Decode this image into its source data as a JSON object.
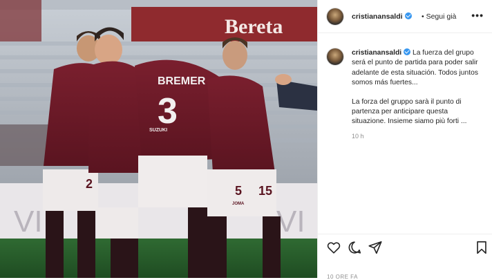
{
  "post": {
    "username": "cristianansaldi",
    "follow_label": "• Segui già",
    "more_label": "•••",
    "caption_es": "La fuerza del grupo será el punto de partida para poder salir adelante de esta situación. Todos juntos somos más fuertes...",
    "caption_it": "La forza del gruppo sarà il punto di partenza per anticipare questa situazione. Insieme siamo più forti ...",
    "time_ago": "10 h",
    "date_label": "10 ORE FA"
  },
  "photo": {
    "banner_text": "Bereta",
    "player_name": "BREMER",
    "player_number": "3",
    "number_2": "2",
    "number_5": "5",
    "number_15": "15",
    "sponsor": "SUZUKI",
    "kit_brand": "JOMA",
    "board_text": "VI"
  },
  "icons": [
    "verified-badge-icon",
    "heart-icon",
    "comment-icon",
    "share-icon",
    "bookmark-icon"
  ],
  "colors": {
    "accent": "#3897f0",
    "kit": "#6e1a28"
  }
}
